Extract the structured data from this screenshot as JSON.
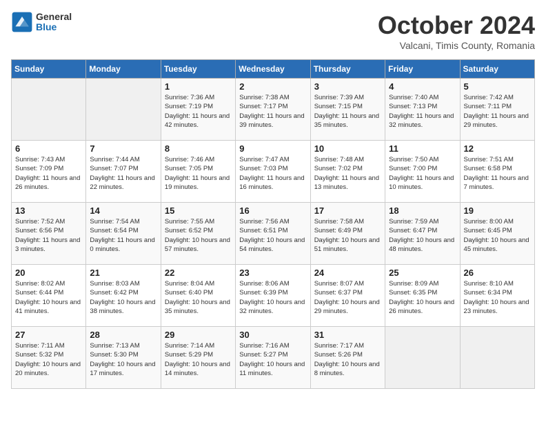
{
  "header": {
    "logo_general": "General",
    "logo_blue": "Blue",
    "month": "October 2024",
    "location": "Valcani, Timis County, Romania"
  },
  "days_of_week": [
    "Sunday",
    "Monday",
    "Tuesday",
    "Wednesday",
    "Thursday",
    "Friday",
    "Saturday"
  ],
  "weeks": [
    [
      {
        "day": "",
        "detail": ""
      },
      {
        "day": "",
        "detail": ""
      },
      {
        "day": "1",
        "detail": "Sunrise: 7:36 AM\nSunset: 7:19 PM\nDaylight: 11 hours and 42 minutes."
      },
      {
        "day": "2",
        "detail": "Sunrise: 7:38 AM\nSunset: 7:17 PM\nDaylight: 11 hours and 39 minutes."
      },
      {
        "day": "3",
        "detail": "Sunrise: 7:39 AM\nSunset: 7:15 PM\nDaylight: 11 hours and 35 minutes."
      },
      {
        "day": "4",
        "detail": "Sunrise: 7:40 AM\nSunset: 7:13 PM\nDaylight: 11 hours and 32 minutes."
      },
      {
        "day": "5",
        "detail": "Sunrise: 7:42 AM\nSunset: 7:11 PM\nDaylight: 11 hours and 29 minutes."
      }
    ],
    [
      {
        "day": "6",
        "detail": "Sunrise: 7:43 AM\nSunset: 7:09 PM\nDaylight: 11 hours and 26 minutes."
      },
      {
        "day": "7",
        "detail": "Sunrise: 7:44 AM\nSunset: 7:07 PM\nDaylight: 11 hours and 22 minutes."
      },
      {
        "day": "8",
        "detail": "Sunrise: 7:46 AM\nSunset: 7:05 PM\nDaylight: 11 hours and 19 minutes."
      },
      {
        "day": "9",
        "detail": "Sunrise: 7:47 AM\nSunset: 7:03 PM\nDaylight: 11 hours and 16 minutes."
      },
      {
        "day": "10",
        "detail": "Sunrise: 7:48 AM\nSunset: 7:02 PM\nDaylight: 11 hours and 13 minutes."
      },
      {
        "day": "11",
        "detail": "Sunrise: 7:50 AM\nSunset: 7:00 PM\nDaylight: 11 hours and 10 minutes."
      },
      {
        "day": "12",
        "detail": "Sunrise: 7:51 AM\nSunset: 6:58 PM\nDaylight: 11 hours and 7 minutes."
      }
    ],
    [
      {
        "day": "13",
        "detail": "Sunrise: 7:52 AM\nSunset: 6:56 PM\nDaylight: 11 hours and 3 minutes."
      },
      {
        "day": "14",
        "detail": "Sunrise: 7:54 AM\nSunset: 6:54 PM\nDaylight: 11 hours and 0 minutes."
      },
      {
        "day": "15",
        "detail": "Sunrise: 7:55 AM\nSunset: 6:52 PM\nDaylight: 10 hours and 57 minutes."
      },
      {
        "day": "16",
        "detail": "Sunrise: 7:56 AM\nSunset: 6:51 PM\nDaylight: 10 hours and 54 minutes."
      },
      {
        "day": "17",
        "detail": "Sunrise: 7:58 AM\nSunset: 6:49 PM\nDaylight: 10 hours and 51 minutes."
      },
      {
        "day": "18",
        "detail": "Sunrise: 7:59 AM\nSunset: 6:47 PM\nDaylight: 10 hours and 48 minutes."
      },
      {
        "day": "19",
        "detail": "Sunrise: 8:00 AM\nSunset: 6:45 PM\nDaylight: 10 hours and 45 minutes."
      }
    ],
    [
      {
        "day": "20",
        "detail": "Sunrise: 8:02 AM\nSunset: 6:44 PM\nDaylight: 10 hours and 41 minutes."
      },
      {
        "day": "21",
        "detail": "Sunrise: 8:03 AM\nSunset: 6:42 PM\nDaylight: 10 hours and 38 minutes."
      },
      {
        "day": "22",
        "detail": "Sunrise: 8:04 AM\nSunset: 6:40 PM\nDaylight: 10 hours and 35 minutes."
      },
      {
        "day": "23",
        "detail": "Sunrise: 8:06 AM\nSunset: 6:39 PM\nDaylight: 10 hours and 32 minutes."
      },
      {
        "day": "24",
        "detail": "Sunrise: 8:07 AM\nSunset: 6:37 PM\nDaylight: 10 hours and 29 minutes."
      },
      {
        "day": "25",
        "detail": "Sunrise: 8:09 AM\nSunset: 6:35 PM\nDaylight: 10 hours and 26 minutes."
      },
      {
        "day": "26",
        "detail": "Sunrise: 8:10 AM\nSunset: 6:34 PM\nDaylight: 10 hours and 23 minutes."
      }
    ],
    [
      {
        "day": "27",
        "detail": "Sunrise: 7:11 AM\nSunset: 5:32 PM\nDaylight: 10 hours and 20 minutes."
      },
      {
        "day": "28",
        "detail": "Sunrise: 7:13 AM\nSunset: 5:30 PM\nDaylight: 10 hours and 17 minutes."
      },
      {
        "day": "29",
        "detail": "Sunrise: 7:14 AM\nSunset: 5:29 PM\nDaylight: 10 hours and 14 minutes."
      },
      {
        "day": "30",
        "detail": "Sunrise: 7:16 AM\nSunset: 5:27 PM\nDaylight: 10 hours and 11 minutes."
      },
      {
        "day": "31",
        "detail": "Sunrise: 7:17 AM\nSunset: 5:26 PM\nDaylight: 10 hours and 8 minutes."
      },
      {
        "day": "",
        "detail": ""
      },
      {
        "day": "",
        "detail": ""
      }
    ]
  ]
}
